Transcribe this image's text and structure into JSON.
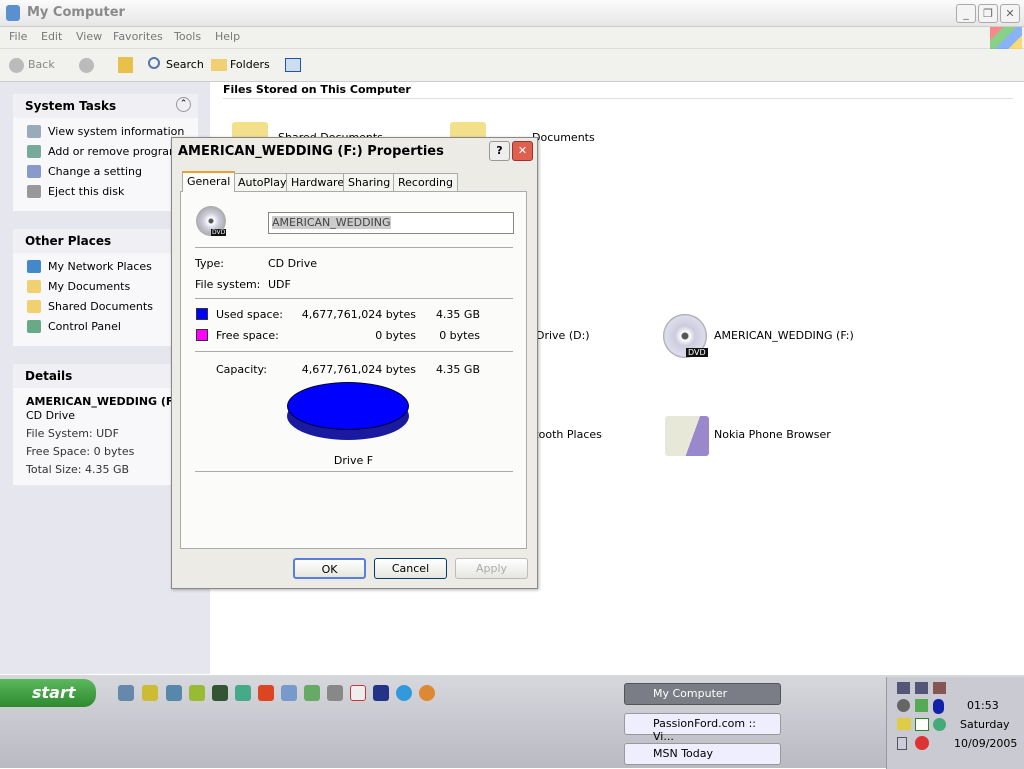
{
  "window": {
    "title": "My Computer",
    "menu": [
      "File",
      "Edit",
      "View",
      "Favorites",
      "Tools",
      "Help"
    ],
    "toolbar": {
      "back": "Back",
      "search": "Search",
      "folders": "Folders"
    }
  },
  "sidebar": {
    "system_tasks": {
      "title": "System Tasks",
      "items": [
        "View system information",
        "Add or remove programs",
        "Change a setting",
        "Eject this disk"
      ]
    },
    "other_places": {
      "title": "Other Places",
      "items": [
        "My Network Places",
        "My Documents",
        "Shared Documents",
        "Control Panel"
      ]
    },
    "details": {
      "title": "Details",
      "name": "AMERICAN_WEDDING (F:)",
      "type": "CD Drive",
      "file_system": "File System: UDF",
      "free_space": "Free Space: 0 bytes",
      "total_size": "Total Size: 4.35 GB"
    }
  },
  "main": {
    "section_title": "Files Stored on This Computer",
    "items": [
      "Shared Documents",
      "Documents",
      "Drive (D:)",
      "AMERICAN_WEDDING (F:)",
      "Bluetooth Places",
      "Nokia Phone Browser"
    ]
  },
  "dialog": {
    "title": "AMERICAN_WEDDING (F:) Properties",
    "tabs": [
      "General",
      "AutoPlay",
      "Hardware",
      "Sharing",
      "Recording"
    ],
    "label": "AMERICAN_WEDDING",
    "type_label": "Type:",
    "type": "CD Drive",
    "fs_label": "File system:",
    "fs": "UDF",
    "used_label": "Used space:",
    "used_bytes": "4,677,761,024 bytes",
    "used_gb": "4.35 GB",
    "free_label": "Free space:",
    "free_bytes": "0 bytes",
    "free_gb": "0 bytes",
    "cap_label": "Capacity:",
    "cap_bytes": "4,677,761,024 bytes",
    "cap_gb": "4.35 GB",
    "drive": "Drive F",
    "used_fraction": 1.0,
    "used_color": "#0000ff",
    "free_color": "#ff00ff",
    "ok": "OK",
    "cancel": "Cancel",
    "apply": "Apply",
    "dvd_badge": "DVD"
  },
  "taskbar": {
    "start": "start",
    "tasks": [
      "My Computer",
      "PassionFord.com :: Vi...",
      "MSN Today"
    ],
    "clock": {
      "time": "01:53",
      "day": "Saturday",
      "date": "10/09/2005"
    }
  }
}
